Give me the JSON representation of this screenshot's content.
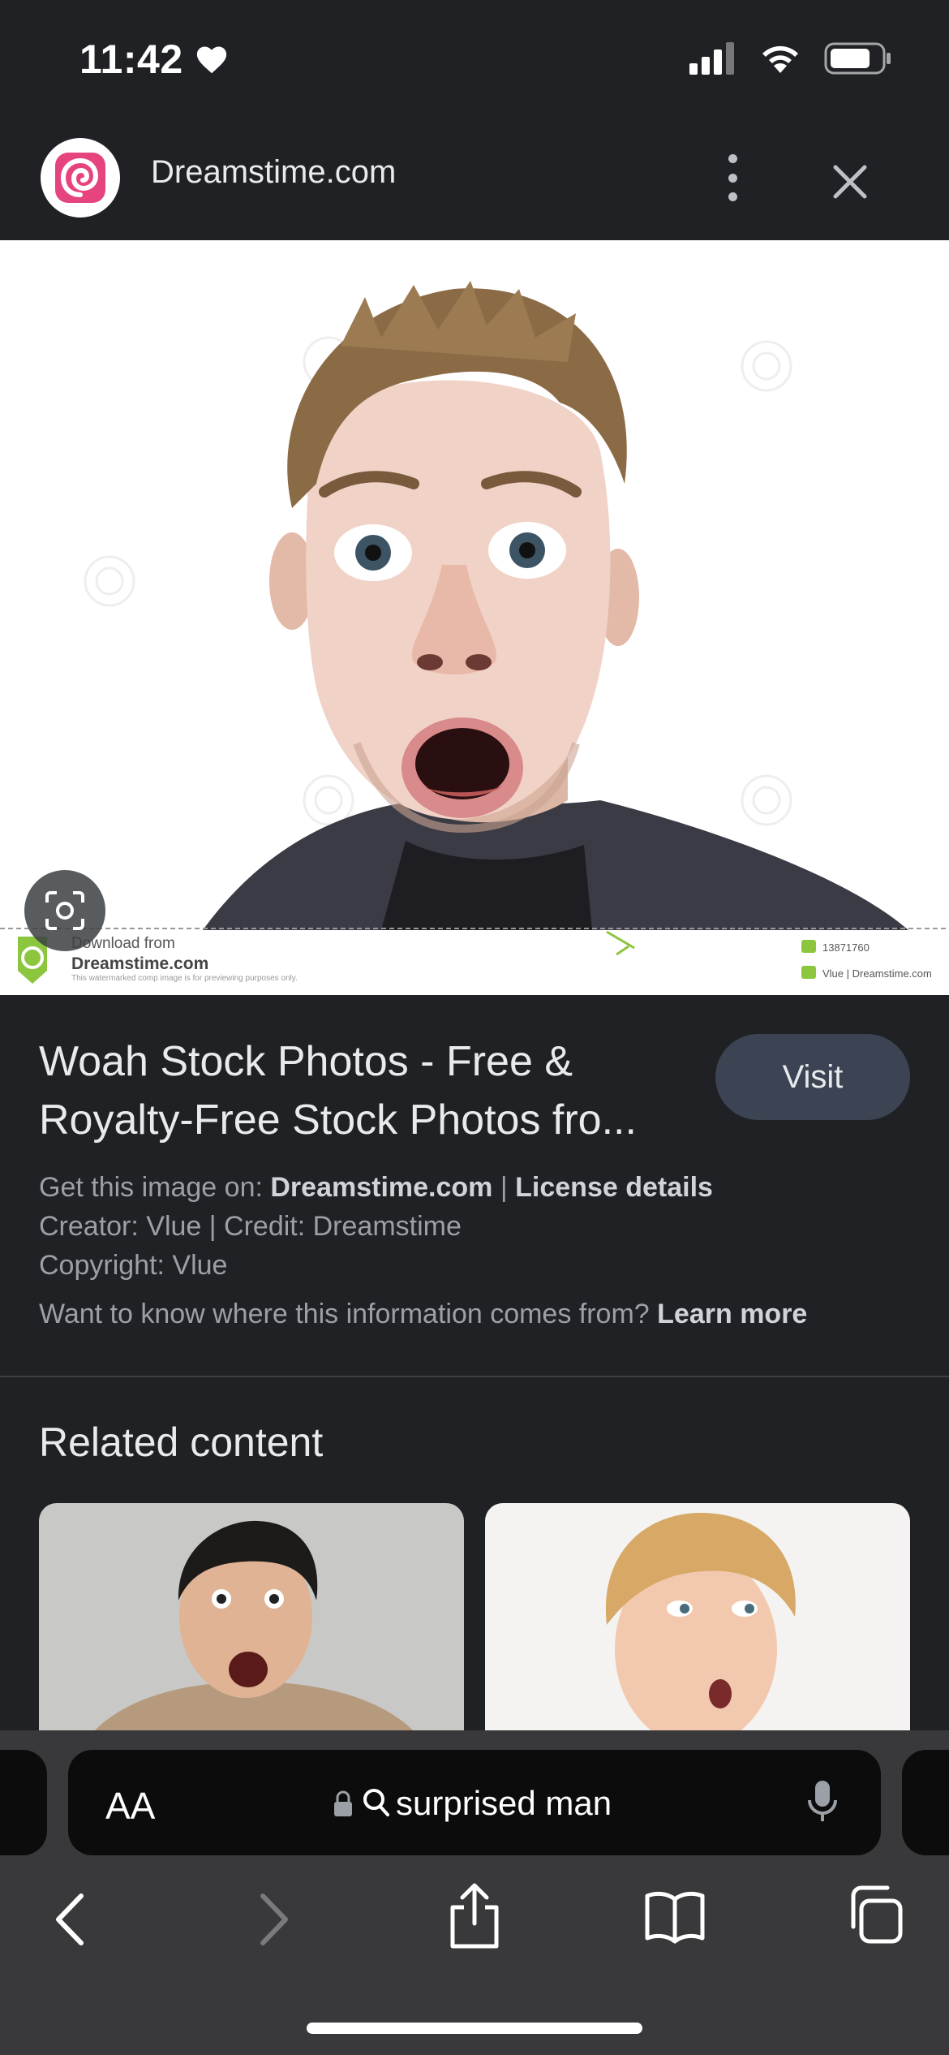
{
  "status": {
    "time": "11:42"
  },
  "header": {
    "site_name": "Dreamstime.com"
  },
  "hero": {
    "watermark_download": "Download from",
    "watermark_site": "Dreamstime.com",
    "watermark_note": "This watermarked comp image is for previewing purposes only.",
    "watermark_id": "13871760",
    "watermark_credit": "Vlue | Dreamstime.com"
  },
  "result": {
    "title": "Woah Stock Photos - Free & Royalty-Free Stock Photos fro...",
    "visit_label": "Visit",
    "get_image_prefix": "Get this image on:",
    "source_link": "Dreamstime.com",
    "separator": "|",
    "license_link": "License details",
    "creator_line": "Creator: Vlue | Credit: Dreamstime",
    "copyright_line": "Copyright: Vlue",
    "info_question": "Want to know where this information comes from?",
    "learn_more": "Learn more"
  },
  "related": {
    "title": "Related content"
  },
  "browser": {
    "text_size_label": "AA",
    "search_query": "surprised man"
  },
  "colors": {
    "background": "#202124",
    "visit_button": "#3c4453",
    "toolbar": "#39393b",
    "logo_pink": "#e6447f"
  }
}
